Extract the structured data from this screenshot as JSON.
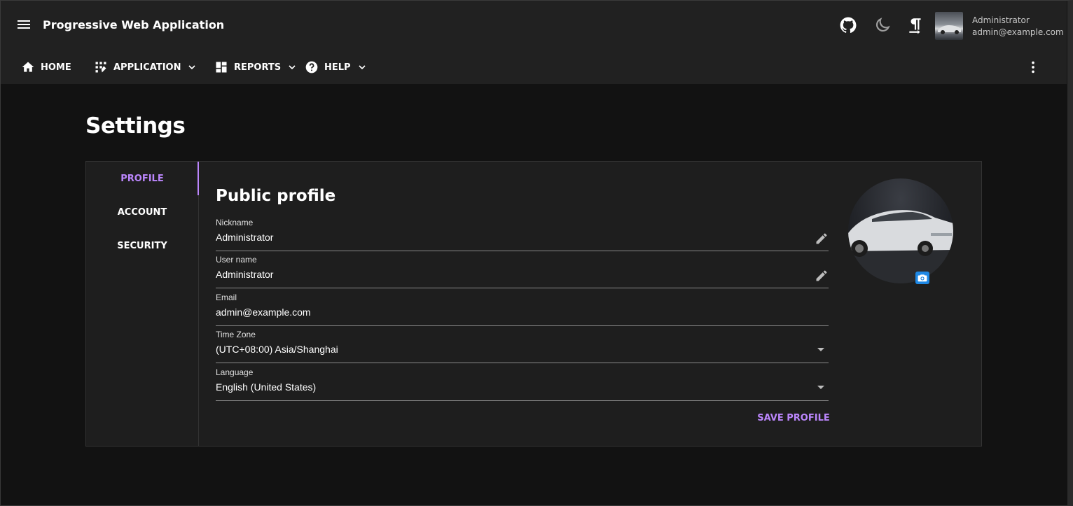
{
  "app": {
    "title": "Progressive Web Application"
  },
  "user": {
    "name": "Administrator",
    "email": "admin@example.com"
  },
  "nav": {
    "items": [
      {
        "label": "HOME",
        "icon": "home-icon",
        "has_menu": false
      },
      {
        "label": "APPLICATION",
        "icon": "apps-icon",
        "has_menu": true
      },
      {
        "label": "REPORTS",
        "icon": "dashboard-icon",
        "has_menu": true
      },
      {
        "label": "HELP",
        "icon": "help-circle-icon",
        "has_menu": true
      }
    ]
  },
  "page": {
    "title": "Settings"
  },
  "settings": {
    "tabs": [
      {
        "label": "PROFILE"
      },
      {
        "label": "ACCOUNT"
      },
      {
        "label": "SECURITY"
      }
    ],
    "active_tab": "PROFILE",
    "section_title": "Public profile",
    "fields": {
      "nickname": {
        "label": "Nickname",
        "value": "Administrator"
      },
      "username": {
        "label": "User name",
        "value": "Administrator"
      },
      "email": {
        "label": "Email",
        "value": "admin@example.com"
      },
      "timezone": {
        "label": "Time Zone",
        "value": "(UTC+08:00) Asia/Shanghai"
      },
      "language": {
        "label": "Language",
        "value": "English (United States)"
      }
    },
    "save_label": "SAVE PROFILE"
  },
  "colors": {
    "accent": "#bb86fc",
    "appbar": "#212121",
    "background": "#121212",
    "card": "#1e1e1e",
    "camera_button": "#1e88e5"
  }
}
